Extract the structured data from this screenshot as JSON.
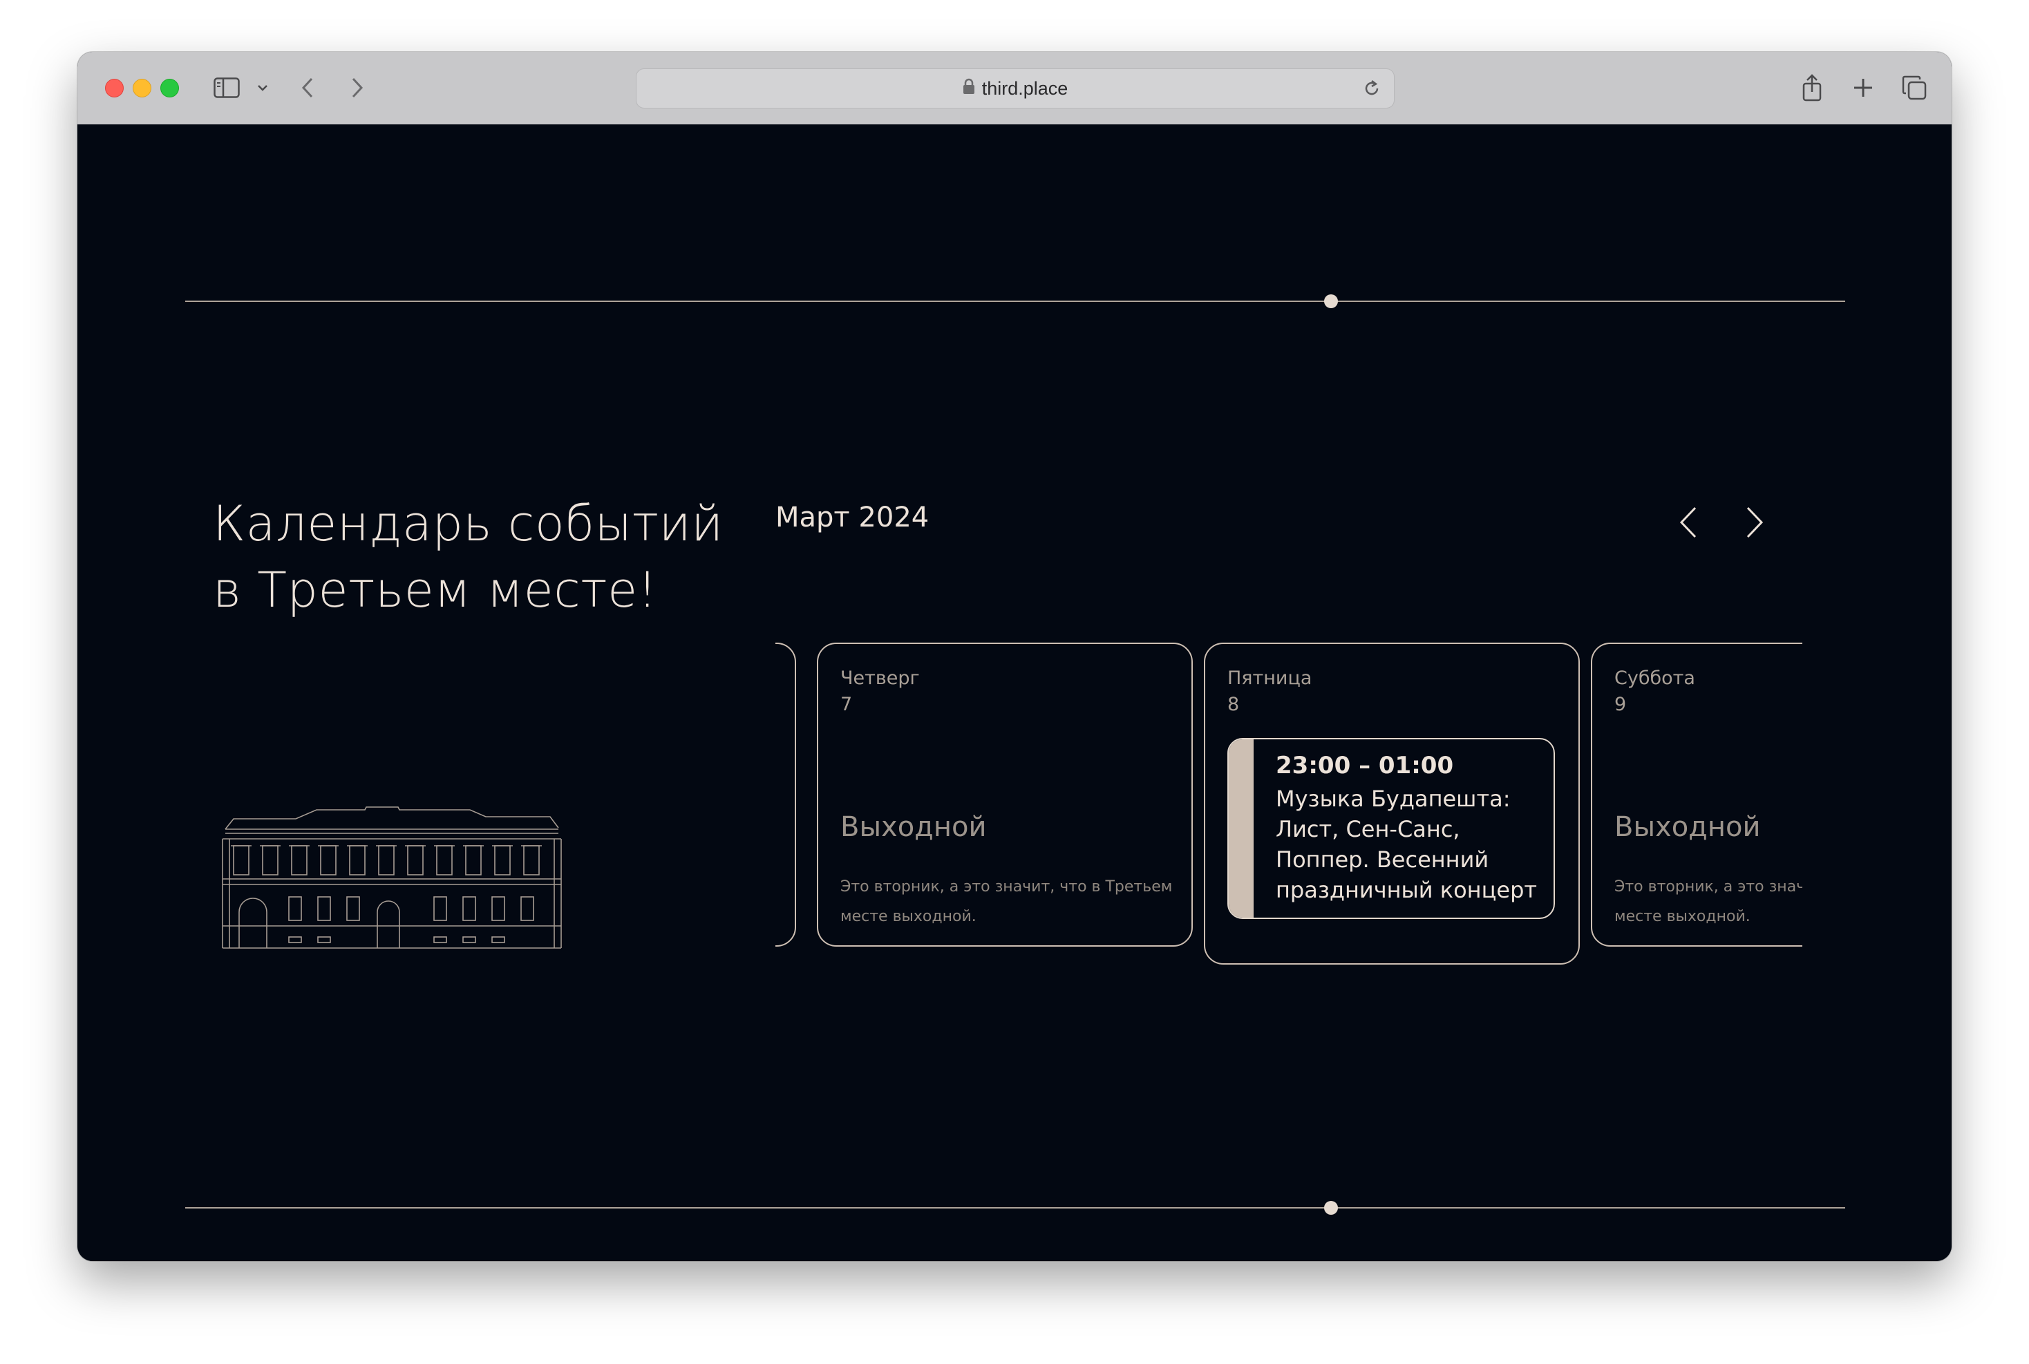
{
  "browser": {
    "url": "third.place"
  },
  "page": {
    "title_line1": "Календарь событий",
    "title_line2": "в Третьем месте!",
    "month": "Март 2024"
  },
  "cards": [
    {
      "day": "Четверг",
      "date": "7",
      "status": "Выходной",
      "description": "Это вторник, а это значит, что в Третьем месте выходной."
    },
    {
      "day": "Пятница",
      "date": "8",
      "event": {
        "time": "23:00 – 01:00",
        "title": "Музыка Будапешта: Лист, Сен-Санс, Поппер. Весенний праздничный концерт"
      }
    },
    {
      "day": "Суббота",
      "date": "9",
      "status": "Выходной",
      "description": "Это вторник, а это значит, что в Третьем месте выходной."
    }
  ],
  "colors": {
    "background": "#030812",
    "accent": "#cdbfb3",
    "text": "#ece2d9"
  }
}
